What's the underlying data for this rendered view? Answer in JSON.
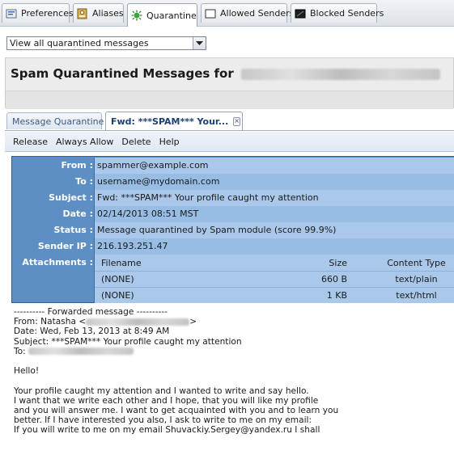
{
  "top_tabs": [
    {
      "label": "Preferences",
      "icon": "preferences-icon"
    },
    {
      "label": "Aliases",
      "icon": "aliases-icon"
    },
    {
      "label": "Quarantine",
      "icon": "quarantine-icon"
    },
    {
      "label": "Allowed Senders",
      "icon": "allowed-senders-icon"
    },
    {
      "label": "Blocked Senders",
      "icon": "blocked-senders-icon"
    }
  ],
  "filter": {
    "selected": "View all quarantined messages"
  },
  "page_title": "Spam Quarantined Messages for",
  "inner_tabs": [
    {
      "label": "Message Quarantine"
    },
    {
      "label": "Fwd: ***SPAM*** Your..."
    }
  ],
  "toolbar": {
    "release": "Release",
    "always_allow": "Always Allow",
    "delete": "Delete",
    "help": "Help"
  },
  "header": {
    "from_label": "From :",
    "from": "spammer@example.com",
    "to_label": "To :",
    "to": "username@mydomain.com",
    "subject_label": "Subject :",
    "subject": "Fwd: ***SPAM*** Your profile caught my attention",
    "date_label": "Date :",
    "date": "02/14/2013 08:51 MST",
    "status_label": "Status :",
    "status": "Message quarantined by Spam module (score 99.9%)",
    "ip_label": "Sender IP :",
    "ip": "216.193.251.47",
    "attach_label": "Attachments :"
  },
  "attachments": {
    "columns": [
      "Filename",
      "Size",
      "Content Type"
    ],
    "rows": [
      {
        "filename": "(NONE)",
        "size": "660 B",
        "type": "text/plain"
      },
      {
        "filename": "(NONE)",
        "size": "1 KB",
        "type": "text/html"
      }
    ]
  },
  "body": {
    "forwarded": "---------- Forwarded message ----------",
    "from_prefix": "From: Natasha <",
    "from_suffix": ">",
    "date": "Date: Wed, Feb 13, 2013 at 8:49 AM",
    "subject": "Subject: ***SPAM*** Your profile caught my attention",
    "to_prefix": "To:",
    "greeting": "Hello!",
    "p1": "Your profile caught my attention and I wanted to write and say hello.",
    "p2": "I want that we write each other and I hope, that you will like my profile",
    "p3": "and you will answer me. I want to get acquainted with you and to learn you",
    "p4": "better. If I have interested you also, I ask to write to me on my email:",
    "p5": "If you will write to me on my email Shuvackiy.Sergey@yandex.ru I shall"
  }
}
